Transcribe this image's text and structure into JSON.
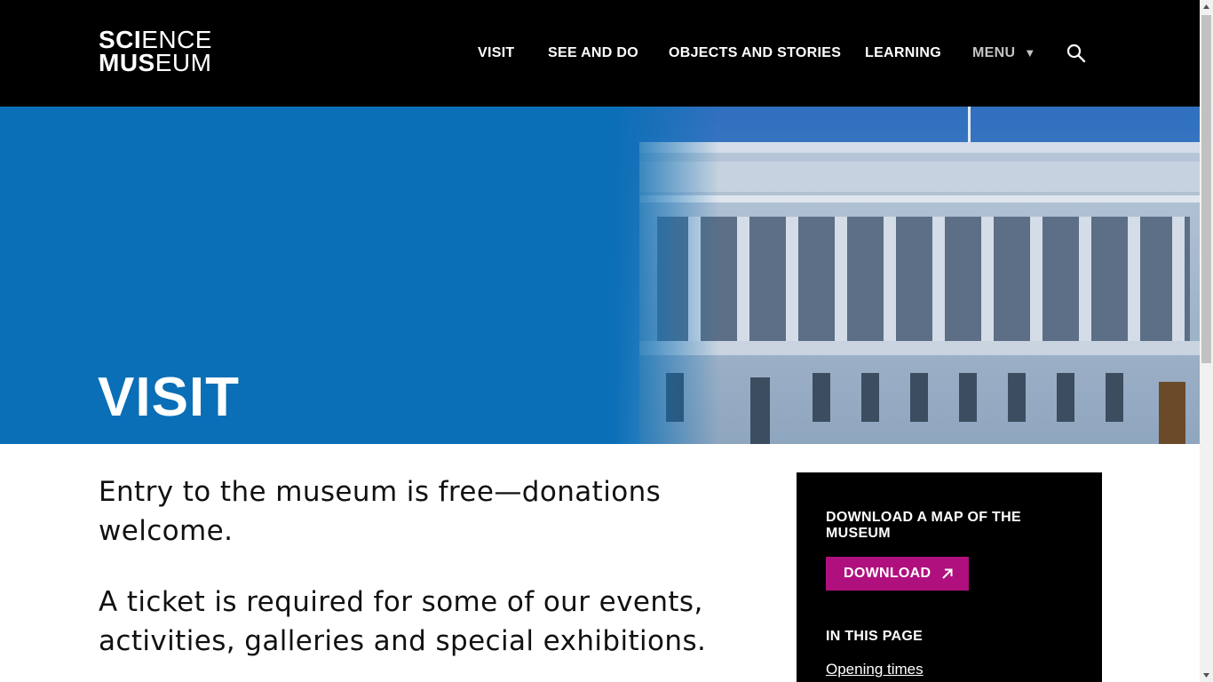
{
  "header": {
    "logo": {
      "line1_bold": "SCI",
      "line1_light": "ENCE",
      "line2_bold": "MUS",
      "line2_light": "EUM"
    },
    "nav": [
      {
        "label": "VISIT"
      },
      {
        "label": "SEE AND DO"
      },
      {
        "label": "OBJECTS AND STORIES"
      },
      {
        "label": "LEARNING"
      }
    ],
    "menu_label": "MENU",
    "menu_caret": "▼",
    "search_icon": "search-icon"
  },
  "hero": {
    "title": "VISIT",
    "background_color": "#0a6fb6"
  },
  "content": {
    "intro_1": "Entry to the museum is free—donations welcome.",
    "intro_2": "A ticket is required for some of our events, activities, galleries and special exhibitions."
  },
  "sidebar": {
    "map_title": "DOWNLOAD A MAP OF THE MUSEUM",
    "download_label": "DOWNLOAD",
    "download_icon": "arrow-up-right-icon",
    "download_color": "#b0107e",
    "in_page_title": "IN THIS PAGE",
    "in_page_links": [
      {
        "label": "Opening times"
      }
    ]
  }
}
